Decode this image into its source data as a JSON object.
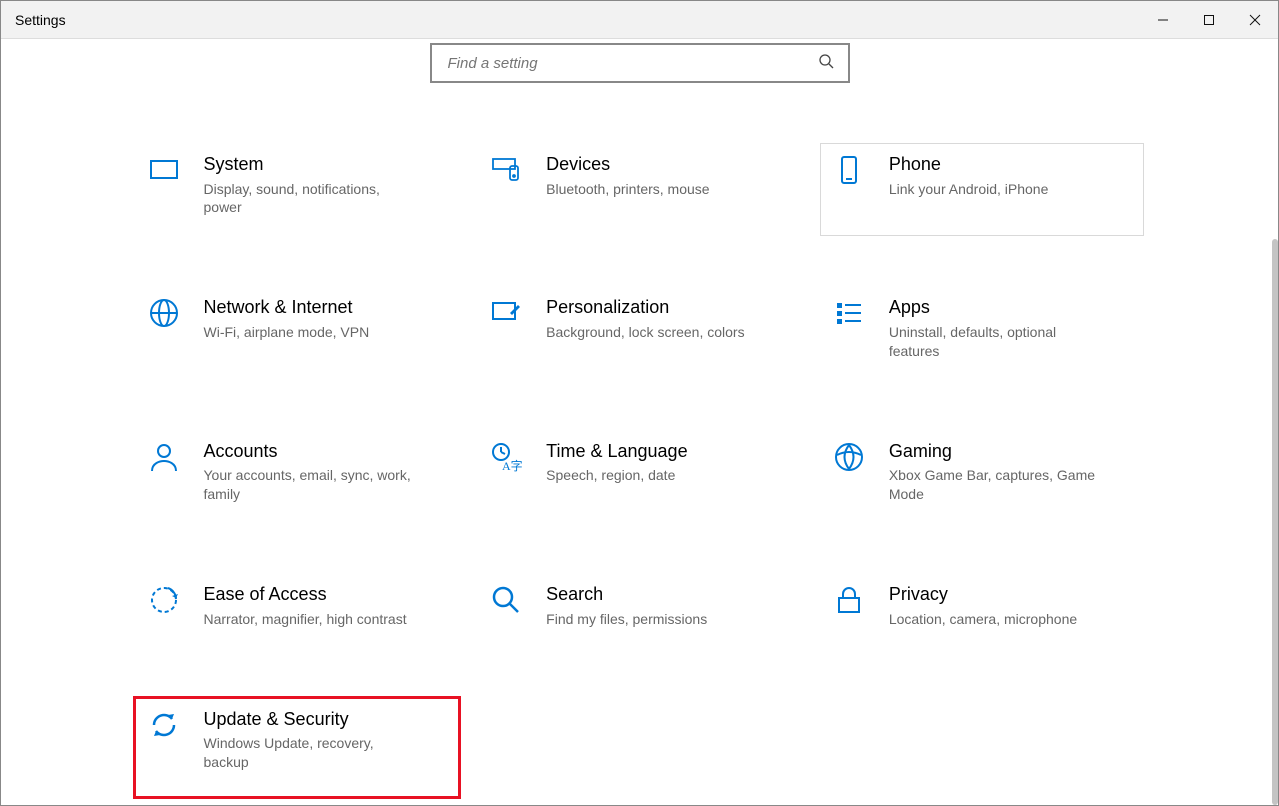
{
  "window": {
    "title": "Settings"
  },
  "search": {
    "placeholder": "Find a setting"
  },
  "tiles": {
    "system": {
      "title": "System",
      "sub": "Display, sound, notifications, power"
    },
    "devices": {
      "title": "Devices",
      "sub": "Bluetooth, printers, mouse"
    },
    "phone": {
      "title": "Phone",
      "sub": "Link your Android, iPhone"
    },
    "network": {
      "title": "Network & Internet",
      "sub": "Wi-Fi, airplane mode, VPN"
    },
    "personal": {
      "title": "Personalization",
      "sub": "Background, lock screen, colors"
    },
    "apps": {
      "title": "Apps",
      "sub": "Uninstall, defaults, optional features"
    },
    "accounts": {
      "title": "Accounts",
      "sub": "Your accounts, email, sync, work, family"
    },
    "time": {
      "title": "Time & Language",
      "sub": "Speech, region, date"
    },
    "gaming": {
      "title": "Gaming",
      "sub": "Xbox Game Bar, captures, Game Mode"
    },
    "ease": {
      "title": "Ease of Access",
      "sub": "Narrator, magnifier, high contrast"
    },
    "searchcat": {
      "title": "Search",
      "sub": "Find my files, permissions"
    },
    "privacy": {
      "title": "Privacy",
      "sub": "Location, camera, microphone"
    },
    "update": {
      "title": "Update & Security",
      "sub": "Windows Update, recovery, backup"
    }
  }
}
